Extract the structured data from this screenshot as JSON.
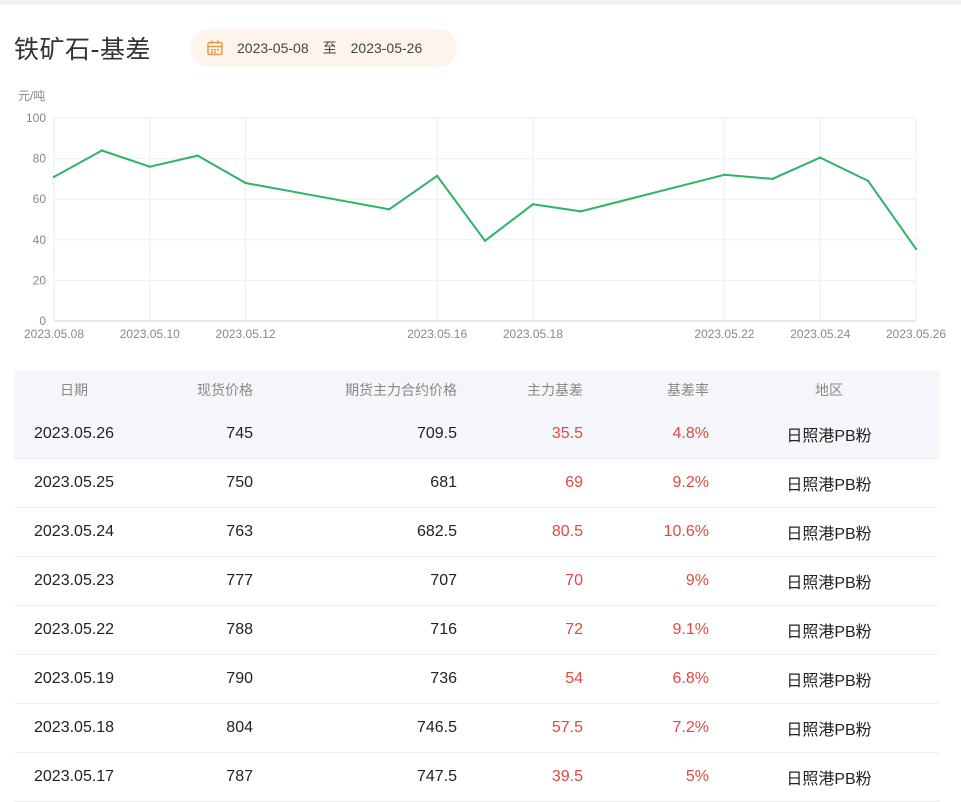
{
  "header": {
    "title": "铁矿石-基差",
    "date_from": "2023-05-08",
    "date_sep": "至",
    "date_to": "2023-05-26"
  },
  "colors": {
    "line": "#2db566",
    "negative_red": "#e04a3f",
    "pill_bg": "#fdf4ec",
    "calendar_icon": "#e39a4a"
  },
  "chart_data": {
    "type": "line",
    "title": "",
    "ylabel": "元/吨",
    "xlabel": "",
    "ylim": [
      0,
      100
    ],
    "yticks": [
      0,
      20,
      40,
      60,
      80,
      100
    ],
    "xtick_labels": [
      "2023.05.08",
      "2023.05.10",
      "2023.05.12",
      "2023.05.16",
      "2023.05.18",
      "2023.05.22",
      "2023.05.24",
      "2023.05.26"
    ],
    "grid": true,
    "x": [
      "2023.05.08",
      "2023.05.09",
      "2023.05.10",
      "2023.05.11",
      "2023.05.12",
      "2023.05.15",
      "2023.05.16",
      "2023.05.17",
      "2023.05.18",
      "2023.05.19",
      "2023.05.22",
      "2023.05.23",
      "2023.05.24",
      "2023.05.25",
      "2023.05.26"
    ],
    "series": [
      {
        "values": [
          71,
          84,
          76,
          81.5,
          68,
          55,
          71.5,
          39.5,
          57.5,
          54,
          72,
          70,
          80.5,
          69,
          35.5
        ]
      }
    ]
  },
  "table": {
    "headers": {
      "date": "日期",
      "spot": "现货价格",
      "futures": "期货主力合约价格",
      "basis": "主力基差",
      "rate": "基差率",
      "region": "地区"
    },
    "rows": [
      {
        "date": "2023.05.26",
        "spot": "745",
        "futures": "709.5",
        "basis": "35.5",
        "rate": "4.8%",
        "region": "日照港PB粉"
      },
      {
        "date": "2023.05.25",
        "spot": "750",
        "futures": "681",
        "basis": "69",
        "rate": "9.2%",
        "region": "日照港PB粉"
      },
      {
        "date": "2023.05.24",
        "spot": "763",
        "futures": "682.5",
        "basis": "80.5",
        "rate": "10.6%",
        "region": "日照港PB粉"
      },
      {
        "date": "2023.05.23",
        "spot": "777",
        "futures": "707",
        "basis": "70",
        "rate": "9%",
        "region": "日照港PB粉"
      },
      {
        "date": "2023.05.22",
        "spot": "788",
        "futures": "716",
        "basis": "72",
        "rate": "9.1%",
        "region": "日照港PB粉"
      },
      {
        "date": "2023.05.19",
        "spot": "790",
        "futures": "736",
        "basis": "54",
        "rate": "6.8%",
        "region": "日照港PB粉"
      },
      {
        "date": "2023.05.18",
        "spot": "804",
        "futures": "746.5",
        "basis": "57.5",
        "rate": "7.2%",
        "region": "日照港PB粉"
      },
      {
        "date": "2023.05.17",
        "spot": "787",
        "futures": "747.5",
        "basis": "39.5",
        "rate": "5%",
        "region": "日照港PB粉"
      }
    ]
  }
}
